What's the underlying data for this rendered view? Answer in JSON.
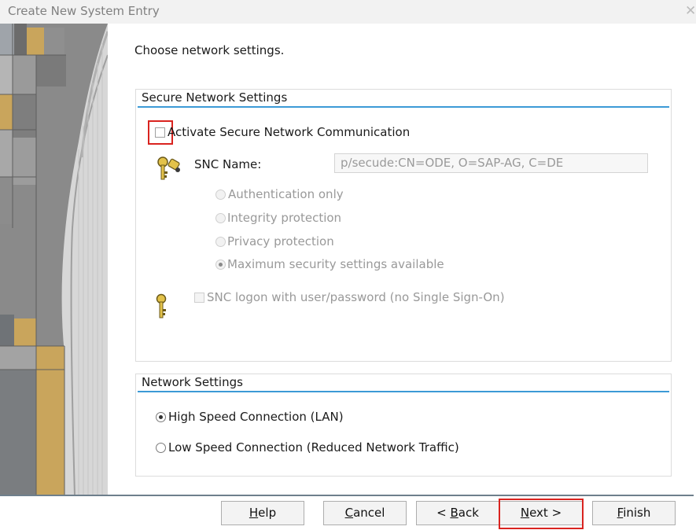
{
  "window": {
    "title": "Create New System Entry",
    "close_glyph": "✕"
  },
  "instruction": "Choose network settings.",
  "secure_group": {
    "title": "Secure Network Settings",
    "activate_label": "Activate Secure Network Communication",
    "snc_name_label": "SNC Name:",
    "snc_name_value": "p/secude:CN=ODE, O=SAP-AG, C=DE",
    "protection_options": [
      {
        "label": "Authentication only",
        "selected": false
      },
      {
        "label": "Integrity protection",
        "selected": false
      },
      {
        "label": "Privacy protection",
        "selected": false
      },
      {
        "label": "Maximum security settings available",
        "selected": true
      }
    ],
    "snc_logon_label": "SNC logon with user/password (no Single Sign-On)"
  },
  "network_group": {
    "title": "Network Settings",
    "options": [
      {
        "label": "High Speed Connection (LAN)",
        "selected": true
      },
      {
        "label": "Low Speed Connection (Reduced Network Traffic)",
        "selected": false
      }
    ]
  },
  "buttons": {
    "help": {
      "mnemonic": "H",
      "rest": "elp"
    },
    "cancel": {
      "mnemonic": "C",
      "rest": "ancel"
    },
    "back": {
      "prefix": "< ",
      "mnemonic": "B",
      "rest": "ack"
    },
    "next": {
      "mnemonic": "N",
      "rest": "ext >"
    },
    "finish": {
      "mnemonic": "F",
      "rest": "inish"
    }
  },
  "colors": {
    "accent_line": "#3c9ad6",
    "highlight": "#d9231f",
    "footer_line": "#6e7f8c"
  },
  "icons": [
    "close-icon",
    "snc-key-icon",
    "key-icon"
  ]
}
